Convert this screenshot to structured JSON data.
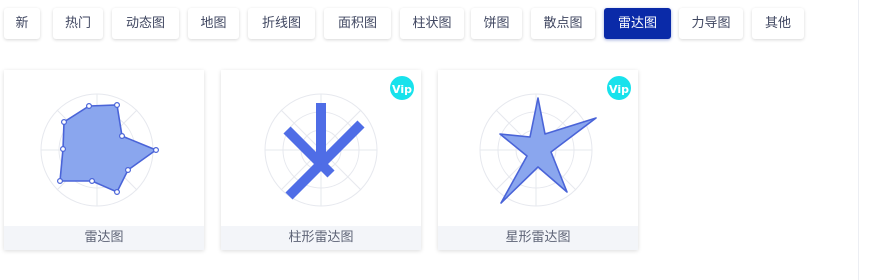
{
  "tabs": [
    {
      "label": "新",
      "active": false
    },
    {
      "label": "热门",
      "active": false
    },
    {
      "label": "动态图",
      "active": false
    },
    {
      "label": "地图",
      "active": false
    },
    {
      "label": "折线图",
      "active": false
    },
    {
      "label": "面积图",
      "active": false
    },
    {
      "label": "柱状图",
      "active": false
    },
    {
      "label": "饼图",
      "active": false
    },
    {
      "label": "散点图",
      "active": false
    },
    {
      "label": "雷达图",
      "active": true
    },
    {
      "label": "力导图",
      "active": false
    },
    {
      "label": "其他",
      "active": false
    }
  ],
  "cards": [
    {
      "title": "雷达图",
      "vip": false,
      "badge": ""
    },
    {
      "title": "柱形雷达图",
      "vip": true,
      "badge": "Vip"
    },
    {
      "title": "星形雷达图",
      "vip": true,
      "badge": "Vip"
    }
  ],
  "colors": {
    "active_tab": "#0a2aa8",
    "radar_fill": "#8aa6ee",
    "radar_stroke": "#4a64d8",
    "vip_badge": "#18e2ec"
  },
  "icons": [
    "radar-chart-thumbnail",
    "bar-radar-chart-thumbnail",
    "star-radar-chart-thumbnail"
  ]
}
